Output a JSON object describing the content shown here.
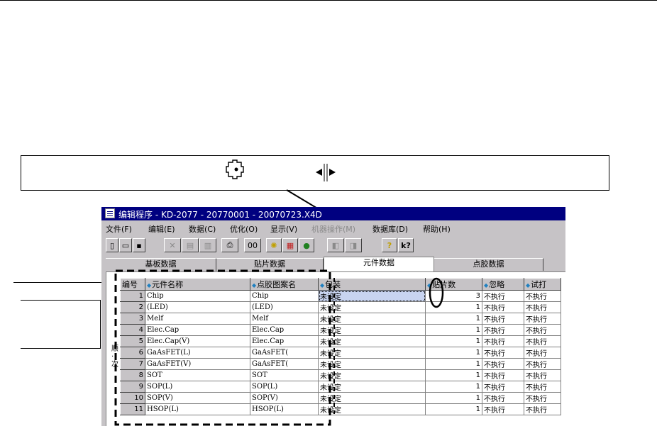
{
  "window": {
    "title": "编辑程序  - KD-2077 - 20770001 - 20070723.X4D"
  },
  "menu": [
    "文件(F)",
    "编辑(E)",
    "数据(C)",
    "优化(O)",
    "显示(V)",
    "机器操作(M)",
    "数据库(D)",
    "帮助(H)"
  ],
  "menu_disabled": "机器操作(M)",
  "toolbar": {
    "icons": [
      "new-icon",
      "open-icon",
      "save-icon",
      "cut-icon",
      "copy-icon",
      "paste-icon",
      "print-icon",
      "find-icon",
      "light-icon",
      "chart-icon",
      "color-icon",
      "first-icon",
      "last-icon",
      "help-icon",
      "pointer-help-icon"
    ],
    "find_label": "00",
    "help_label": "?",
    "pointer_help_label": "k?"
  },
  "tabs": [
    "基板数据",
    "贴片数据",
    "元件数据",
    "点胶数据"
  ],
  "active_tab": "元件数据",
  "side_label": "顺·次",
  "columns": [
    "编号",
    "元件名称",
    "点胶图案名",
    "包装",
    "贴片数",
    "忽略",
    "试打"
  ],
  "rows": [
    {
      "no": "1",
      "name": "Chip",
      "pattern": "Chip",
      "package": "未设定",
      "count": "3",
      "ignore": "不执行",
      "test": "不执行"
    },
    {
      "no": "2",
      "name": "(LED)",
      "pattern": "(LED)",
      "package": "未设定",
      "count": "1",
      "ignore": "不执行",
      "test": "不执行"
    },
    {
      "no": "3",
      "name": "Melf",
      "pattern": "Melf",
      "package": "未设定",
      "count": "1",
      "ignore": "不执行",
      "test": "不执行"
    },
    {
      "no": "4",
      "name": "Elec.Cap",
      "pattern": "Elec.Cap",
      "package": "未设定",
      "count": "1",
      "ignore": "不执行",
      "test": "不执行"
    },
    {
      "no": "5",
      "name": "Elec.Cap(V)",
      "pattern": "Elec.Cap",
      "package": "未设定",
      "count": "1",
      "ignore": "不执行",
      "test": "不执行"
    },
    {
      "no": "6",
      "name": "GaAsFET(L)",
      "pattern": "GaAsFET(",
      "package": "未设定",
      "count": "1",
      "ignore": "不执行",
      "test": "不执行"
    },
    {
      "no": "7",
      "name": "GaAsFET(V)",
      "pattern": "GaAsFET(",
      "package": "未设定",
      "count": "1",
      "ignore": "不执行",
      "test": "不执行"
    },
    {
      "no": "8",
      "name": "SOT",
      "pattern": "SOT",
      "package": "未设定",
      "count": "1",
      "ignore": "不执行",
      "test": "不执行"
    },
    {
      "no": "9",
      "name": "SOP(L)",
      "pattern": "SOP(L)",
      "package": "未设定",
      "count": "1",
      "ignore": "不执行",
      "test": "不执行"
    },
    {
      "no": "10",
      "name": "SOP(V)",
      "pattern": "SOP(V)",
      "package": "未设定",
      "count": "1",
      "ignore": "不执行",
      "test": "不执行"
    },
    {
      "no": "11",
      "name": "HSOP(L)",
      "pattern": "HSOP(L)",
      "package": "未设定",
      "count": "1",
      "ignore": "不执行",
      "test": "不执行"
    }
  ],
  "selected_row": "1",
  "callout": {
    "icons": [
      "sort-cross-icon",
      "column-resize-icon"
    ]
  }
}
